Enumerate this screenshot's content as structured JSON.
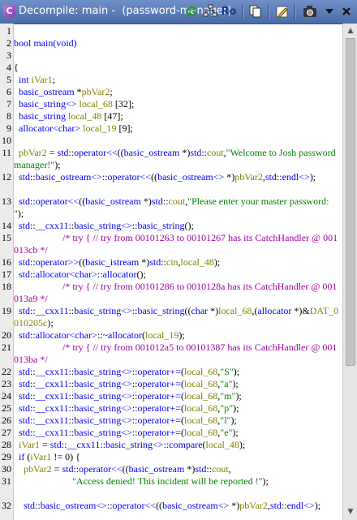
{
  "window": {
    "title": "Decompile: main -  (password-manager)",
    "title_icon": "C"
  },
  "toolbar": {
    "buttons": [
      {
        "name": "refresh-button",
        "icon": "refresh-icon"
      },
      {
        "name": "graph-button",
        "icon": "graph-icon"
      },
      {
        "name": "ro-button",
        "label": "Ro"
      },
      {
        "name": "copy-button",
        "icon": "copy-icon"
      },
      {
        "name": "edit-button",
        "icon": "edit-icon"
      },
      {
        "name": "snapshot-button",
        "icon": "camera-icon"
      },
      {
        "name": "menu-button",
        "icon": "chevron-down-icon"
      },
      {
        "name": "close-button",
        "icon": "close-icon"
      }
    ]
  },
  "lines": [
    {
      "n": "1",
      "tokens": []
    },
    {
      "n": "2",
      "tokens": [
        [
          "bool main(void)",
          "t-d"
        ]
      ]
    },
    {
      "n": "3",
      "tokens": []
    },
    {
      "n": "4",
      "tokens": [
        [
          "{",
          "t"
        ]
      ]
    },
    {
      "n": "5",
      "tokens": [
        [
          "  ",
          "t"
        ],
        [
          "int",
          "t-ty"
        ],
        [
          " ",
          "t"
        ],
        [
          "iVar1",
          "t-v"
        ],
        [
          ";",
          "t"
        ]
      ]
    },
    {
      "n": "6",
      "tokens": [
        [
          "  ",
          "t"
        ],
        [
          "basic_ostream",
          "t-ty"
        ],
        [
          " *",
          "t"
        ],
        [
          "pbVar2",
          "t-v"
        ],
        [
          ";",
          "t"
        ]
      ]
    },
    {
      "n": "7",
      "tokens": [
        [
          "  ",
          "t"
        ],
        [
          "basic_string<>",
          "t-ty"
        ],
        [
          " ",
          "t"
        ],
        [
          "local_68",
          "t-v"
        ],
        [
          " [32];",
          "t"
        ]
      ]
    },
    {
      "n": "8",
      "tokens": [
        [
          "  ",
          "t"
        ],
        [
          "basic_string",
          "t-ty"
        ],
        [
          " ",
          "t"
        ],
        [
          "local_48",
          "t-v"
        ],
        [
          " [47];",
          "t"
        ]
      ]
    },
    {
      "n": "9",
      "tokens": [
        [
          "  ",
          "t"
        ],
        [
          "allocator<char>",
          "t-ty"
        ],
        [
          " ",
          "t"
        ],
        [
          "local_19",
          "t-v"
        ],
        [
          " [9];",
          "t"
        ]
      ]
    },
    {
      "n": "10",
      "tokens": []
    },
    {
      "n": "11",
      "tokens": [
        [
          "  ",
          "t"
        ],
        [
          "pbVar2",
          "t-v"
        ],
        [
          " = ",
          "t"
        ],
        [
          "std",
          "t-f"
        ],
        [
          "::",
          "t"
        ],
        [
          "operator<<",
          "t-f"
        ],
        [
          "((",
          "t"
        ],
        [
          "basic_ostream",
          "t-ty"
        ],
        [
          " *)",
          "t"
        ],
        [
          "std",
          "t-f"
        ],
        [
          "::",
          "t"
        ],
        [
          "cout",
          "t-v"
        ],
        [
          ",",
          "t"
        ],
        [
          "\"Welcome to Josh password manager!\"",
          "t-s"
        ],
        [
          ");",
          "t"
        ]
      ]
    },
    {
      "n": "12",
      "tokens": [
        [
          "  ",
          "t"
        ],
        [
          "std",
          "t-f"
        ],
        [
          "::",
          "t"
        ],
        [
          "basic_ostream<>",
          "t-ty"
        ],
        [
          "::",
          "t"
        ],
        [
          "operator<<",
          "t-f"
        ],
        [
          "((",
          "t"
        ],
        [
          "basic_ostream<>",
          "t-ty"
        ],
        [
          " *)",
          "t"
        ],
        [
          "pbVar2",
          "t-v"
        ],
        [
          ",",
          "t"
        ],
        [
          "std",
          "t-f"
        ],
        [
          "::",
          "t"
        ],
        [
          "endl<>",
          "t-f"
        ],
        [
          ");",
          "t"
        ]
      ]
    },
    {
      "n": "13",
      "tokens": [
        [
          "  ",
          "t"
        ],
        [
          "std",
          "t-f"
        ],
        [
          "::",
          "t"
        ],
        [
          "operator<<",
          "t-f"
        ],
        [
          "((",
          "t"
        ],
        [
          "basic_ostream",
          "t-ty"
        ],
        [
          " *)",
          "t"
        ],
        [
          "std",
          "t-f"
        ],
        [
          "::",
          "t"
        ],
        [
          "cout",
          "t-v"
        ],
        [
          ",",
          "t"
        ],
        [
          "\"Please enter your master password: \"",
          "t-s"
        ],
        [
          ");",
          "t"
        ]
      ]
    },
    {
      "n": "14",
      "tokens": [
        [
          "  ",
          "t"
        ],
        [
          "std",
          "t-f"
        ],
        [
          "::",
          "t"
        ],
        [
          "__cxx11",
          "t-f"
        ],
        [
          "::",
          "t"
        ],
        [
          "basic_string<>",
          "t-ty"
        ],
        [
          "::",
          "t"
        ],
        [
          "basic_string",
          "t-f"
        ],
        [
          "();",
          "t"
        ]
      ]
    },
    {
      "n": "15",
      "tokens": [
        [
          "                    /* try { // try from 00101263 to 00101267 has its CatchHandler @ 001013cb */",
          "t-c"
        ]
      ]
    },
    {
      "n": "16",
      "tokens": [
        [
          "  ",
          "t"
        ],
        [
          "std",
          "t-f"
        ],
        [
          "::",
          "t"
        ],
        [
          "operator>>",
          "t-f"
        ],
        [
          "((",
          "t"
        ],
        [
          "basic_istream",
          "t-ty"
        ],
        [
          " *)",
          "t"
        ],
        [
          "std",
          "t-f"
        ],
        [
          "::",
          "t"
        ],
        [
          "cin",
          "t-v"
        ],
        [
          ",",
          "t"
        ],
        [
          "local_48",
          "t-v"
        ],
        [
          ");",
          "t"
        ]
      ]
    },
    {
      "n": "17",
      "tokens": [
        [
          "  ",
          "t"
        ],
        [
          "std",
          "t-f"
        ],
        [
          "::",
          "t"
        ],
        [
          "allocator<char>",
          "t-ty"
        ],
        [
          "::",
          "t"
        ],
        [
          "allocator",
          "t-f"
        ],
        [
          "();",
          "t"
        ]
      ]
    },
    {
      "n": "18",
      "tokens": [
        [
          "                    /* try { // try from 00101286 to 0010128a has its CatchHandler @ 001013a9 */",
          "t-c"
        ]
      ]
    },
    {
      "n": "19",
      "tokens": [
        [
          "  ",
          "t"
        ],
        [
          "std",
          "t-f"
        ],
        [
          "::",
          "t"
        ],
        [
          "__cxx11",
          "t-f"
        ],
        [
          "::",
          "t"
        ],
        [
          "basic_string<>",
          "t-ty"
        ],
        [
          "::",
          "t"
        ],
        [
          "basic_string",
          "t-f"
        ],
        [
          "((",
          "t"
        ],
        [
          "char",
          "t-ty"
        ],
        [
          " *)",
          "t"
        ],
        [
          "local_68",
          "t-v"
        ],
        [
          ",(",
          "t"
        ],
        [
          "allocator",
          "t-ty"
        ],
        [
          " *)&",
          "t"
        ],
        [
          "DAT_0010205c",
          "t-v"
        ],
        [
          ");",
          "t"
        ]
      ]
    },
    {
      "n": "20",
      "tokens": [
        [
          "  ",
          "t"
        ],
        [
          "std",
          "t-f"
        ],
        [
          "::",
          "t"
        ],
        [
          "allocator<char>",
          "t-ty"
        ],
        [
          "::",
          "t"
        ],
        [
          "~allocator",
          "t-f"
        ],
        [
          "(",
          "t"
        ],
        [
          "local_19",
          "t-v"
        ],
        [
          ");",
          "t"
        ]
      ]
    },
    {
      "n": "21",
      "tokens": [
        [
          "                    /* try { // try from 001012a5 to 00101387 has its CatchHandler @ 001013ba */",
          "t-c"
        ]
      ]
    },
    {
      "n": "22",
      "tokens": [
        [
          "  ",
          "t"
        ],
        [
          "std",
          "t-f"
        ],
        [
          "::",
          "t"
        ],
        [
          "__cxx11",
          "t-f"
        ],
        [
          "::",
          "t"
        ],
        [
          "basic_string<>",
          "t-ty"
        ],
        [
          "::",
          "t"
        ],
        [
          "operator+=",
          "t-f"
        ],
        [
          "(",
          "t"
        ],
        [
          "local_68",
          "t-v"
        ],
        [
          ",",
          "t"
        ],
        [
          "\"S\"",
          "t-s"
        ],
        [
          ");",
          "t"
        ]
      ]
    },
    {
      "n": "23",
      "tokens": [
        [
          "  ",
          "t"
        ],
        [
          "std",
          "t-f"
        ],
        [
          "::",
          "t"
        ],
        [
          "__cxx11",
          "t-f"
        ],
        [
          "::",
          "t"
        ],
        [
          "basic_string<>",
          "t-ty"
        ],
        [
          "::",
          "t"
        ],
        [
          "operator+=",
          "t-f"
        ],
        [
          "(",
          "t"
        ],
        [
          "local_68",
          "t-v"
        ],
        [
          ",",
          "t"
        ],
        [
          "\"a\"",
          "t-s"
        ],
        [
          ");",
          "t"
        ]
      ]
    },
    {
      "n": "24",
      "tokens": [
        [
          "  ",
          "t"
        ],
        [
          "std",
          "t-f"
        ],
        [
          "::",
          "t"
        ],
        [
          "__cxx11",
          "t-f"
        ],
        [
          "::",
          "t"
        ],
        [
          "basic_string<>",
          "t-ty"
        ],
        [
          "::",
          "t"
        ],
        [
          "operator+=",
          "t-f"
        ],
        [
          "(",
          "t"
        ],
        [
          "local_68",
          "t-v"
        ],
        [
          ",",
          "t"
        ],
        [
          "\"m\"",
          "t-s"
        ],
        [
          ");",
          "t"
        ]
      ]
    },
    {
      "n": "25",
      "tokens": [
        [
          "  ",
          "t"
        ],
        [
          "std",
          "t-f"
        ],
        [
          "::",
          "t"
        ],
        [
          "__cxx11",
          "t-f"
        ],
        [
          "::",
          "t"
        ],
        [
          "basic_string<>",
          "t-ty"
        ],
        [
          "::",
          "t"
        ],
        [
          "operator+=",
          "t-f"
        ],
        [
          "(",
          "t"
        ],
        [
          "local_68",
          "t-v"
        ],
        [
          ",",
          "t"
        ],
        [
          "\"p\"",
          "t-s"
        ],
        [
          ");",
          "t"
        ]
      ]
    },
    {
      "n": "26",
      "tokens": [
        [
          "  ",
          "t"
        ],
        [
          "std",
          "t-f"
        ],
        [
          "::",
          "t"
        ],
        [
          "__cxx11",
          "t-f"
        ],
        [
          "::",
          "t"
        ],
        [
          "basic_string<>",
          "t-ty"
        ],
        [
          "::",
          "t"
        ],
        [
          "operator+=",
          "t-f"
        ],
        [
          "(",
          "t"
        ],
        [
          "local_68",
          "t-v"
        ],
        [
          ",",
          "t"
        ],
        [
          "\"l\"",
          "t-s"
        ],
        [
          ");",
          "t"
        ]
      ]
    },
    {
      "n": "27",
      "tokens": [
        [
          "  ",
          "t"
        ],
        [
          "std",
          "t-f"
        ],
        [
          "::",
          "t"
        ],
        [
          "__cxx11",
          "t-f"
        ],
        [
          "::",
          "t"
        ],
        [
          "basic_string<>",
          "t-ty"
        ],
        [
          "::",
          "t"
        ],
        [
          "operator+=",
          "t-f"
        ],
        [
          "(",
          "t"
        ],
        [
          "local_68",
          "t-v"
        ],
        [
          ",",
          "t"
        ],
        [
          "\"e\"",
          "t-s"
        ],
        [
          ");",
          "t"
        ]
      ]
    },
    {
      "n": "28",
      "tokens": [
        [
          "  ",
          "t"
        ],
        [
          "iVar1",
          "t-v"
        ],
        [
          " = ",
          "t"
        ],
        [
          "std",
          "t-f"
        ],
        [
          "::",
          "t"
        ],
        [
          "__cxx11",
          "t-f"
        ],
        [
          "::",
          "t"
        ],
        [
          "basic_string<>",
          "t-ty"
        ],
        [
          "::",
          "t"
        ],
        [
          "compare",
          "t-f"
        ],
        [
          "(",
          "t"
        ],
        [
          "local_48",
          "t-v"
        ],
        [
          ");",
          "t"
        ]
      ]
    },
    {
      "n": "29",
      "tokens": [
        [
          "  ",
          "t"
        ],
        [
          "if",
          "t-kw"
        ],
        [
          " (",
          "t"
        ],
        [
          "iVar1",
          "t-v"
        ],
        [
          " != 0) {",
          "t"
        ]
      ]
    },
    {
      "n": "30",
      "tokens": [
        [
          "    ",
          "t"
        ],
        [
          "pbVar2",
          "t-v"
        ],
        [
          " = ",
          "t"
        ],
        [
          "std",
          "t-f"
        ],
        [
          "::",
          "t"
        ],
        [
          "operator<<",
          "t-f"
        ],
        [
          "((",
          "t"
        ],
        [
          "basic_ostream",
          "t-ty"
        ],
        [
          " *)",
          "t"
        ],
        [
          "std",
          "t-f"
        ],
        [
          "::",
          "t"
        ],
        [
          "cout",
          "t-v"
        ],
        [
          ",",
          "t"
        ]
      ]
    },
    {
      "n": "31",
      "tokens": [
        [
          "                        ",
          "t"
        ],
        [
          "\"Access denied! This incident will be reported !\"",
          "t-s"
        ],
        [
          ");",
          "t"
        ]
      ]
    },
    {
      "n": "32",
      "tokens": [
        [
          "    ",
          "t"
        ],
        [
          "std",
          "t-f"
        ],
        [
          "::",
          "t"
        ],
        [
          "basic_ostream<>",
          "t-ty"
        ],
        [
          "::",
          "t"
        ],
        [
          "operator<<",
          "t-f"
        ],
        [
          "((",
          "t"
        ],
        [
          "basic_ostream<>",
          "t-ty"
        ],
        [
          " *)",
          "t"
        ],
        [
          "pbVar2",
          "t-v"
        ],
        [
          ",",
          "t"
        ],
        [
          "std",
          "t-f"
        ],
        [
          "::",
          "t"
        ],
        [
          "endl<>",
          "t-f"
        ],
        [
          ");",
          "t"
        ]
      ]
    }
  ]
}
